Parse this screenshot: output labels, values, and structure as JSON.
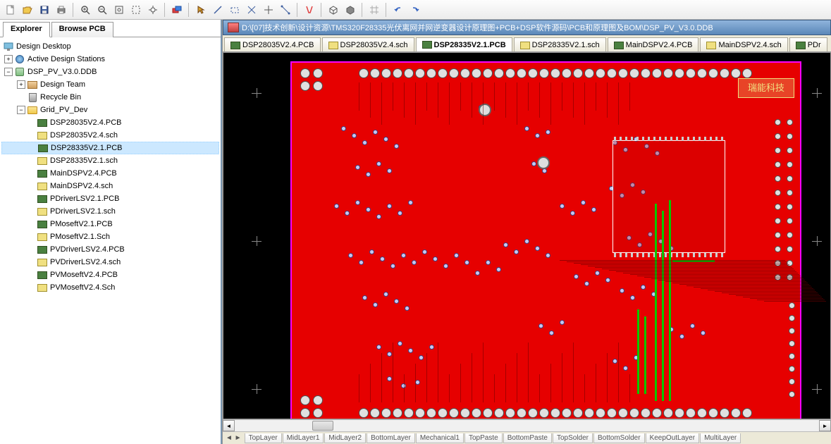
{
  "toolbar": {
    "items": [
      "new",
      "open",
      "save",
      "print",
      "sep",
      "zoom-in",
      "zoom-out",
      "zoom-fit",
      "zoom-select",
      "pan",
      "sep",
      "toggle-layer",
      "sep",
      "select",
      "line",
      "rect",
      "cross",
      "ruler",
      "measure",
      "sep",
      "filter",
      "sep",
      "3d",
      "mirror",
      "sep",
      "grid",
      "sep",
      "undo",
      "redo"
    ]
  },
  "explorer": {
    "tabs": [
      "Explorer",
      "Browse PCB"
    ],
    "active_tab": 0,
    "tree": {
      "root": "Design Desktop",
      "station": "Active Design Stations",
      "project": "DSP_PV_V3.0.DDB",
      "team": "Design Team",
      "bin": "Recycle Bin",
      "folder": "Grid_PV_Dev",
      "files": [
        {
          "name": "DSP28035V2.4.PCB",
          "type": "pcb"
        },
        {
          "name": "DSP28035V2.4.sch",
          "type": "sch"
        },
        {
          "name": "DSP28335V2.1.PCB",
          "type": "pcb",
          "selected": true
        },
        {
          "name": "DSP28335V2.1.sch",
          "type": "sch"
        },
        {
          "name": "MainDSPV2.4.PCB",
          "type": "pcb"
        },
        {
          "name": "MainDSPV2.4.sch",
          "type": "sch"
        },
        {
          "name": "PDriverLSV2.1.PCB",
          "type": "pcb"
        },
        {
          "name": "PDriverLSV2.1.sch",
          "type": "sch"
        },
        {
          "name": "PMoseftV2.1.PCB",
          "type": "pcb"
        },
        {
          "name": "PMoseftV2.1.Sch",
          "type": "sch"
        },
        {
          "name": "PVDriverLSV2.4.PCB",
          "type": "pcb"
        },
        {
          "name": "PVDriverLSV2.4.sch",
          "type": "sch"
        },
        {
          "name": "PVMoseftV2.4.PCB",
          "type": "pcb"
        },
        {
          "name": "PVMoseftV2.4.Sch",
          "type": "sch"
        }
      ]
    }
  },
  "document": {
    "title": "D:\\[07]技术创新\\设计资源\\TMS320F28335光伏离网并网逆变器设计原理图+PCB+DSP软件源码\\PCB和原理图及BOM\\DSP_PV_V3.0.DDB",
    "tabs": [
      {
        "label": "DSP28035V2.4.PCB",
        "type": "pcb"
      },
      {
        "label": "DSP28035V2.4.sch",
        "type": "sch"
      },
      {
        "label": "DSP28335V2.1.PCB",
        "type": "pcb",
        "active": true
      },
      {
        "label": "DSP28335V2.1.sch",
        "type": "sch"
      },
      {
        "label": "MainDSPV2.4.PCB",
        "type": "pcb"
      },
      {
        "label": "MainDSPV2.4.sch",
        "type": "sch"
      },
      {
        "label": "PDr",
        "type": "pcb"
      }
    ],
    "layers": [
      "TopLayer",
      "MidLayer1",
      "MidLayer2",
      "BottomLayer",
      "Mechanical1",
      "TopPaste",
      "BottomPaste",
      "TopSolder",
      "BottomSolder",
      "KeepOutLayer",
      "MultiLayer"
    ],
    "silk_text": "瑞能科技"
  }
}
